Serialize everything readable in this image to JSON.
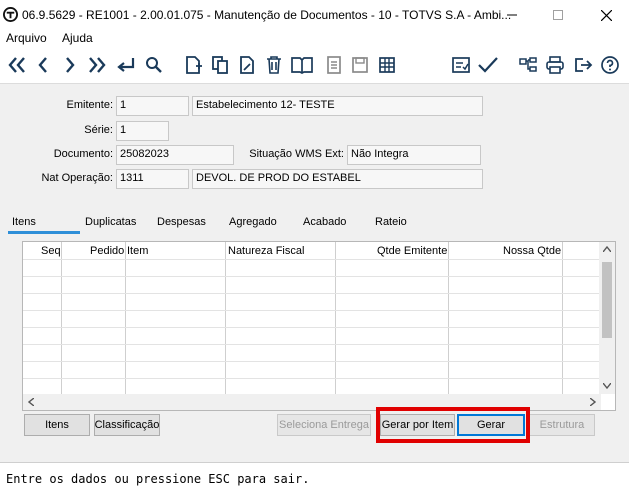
{
  "window": {
    "title": "06.9.5629 - RE1001 - 2.00.01.075 - Manutenção de Documentos - 10 - TOTVS S.A - Ambi..."
  },
  "menu": {
    "items": [
      "Arquivo",
      "Ajuda"
    ]
  },
  "toolbar": {
    "icons": [
      "first-icon",
      "previous-icon",
      "next-icon",
      "last-icon",
      "goto-icon",
      "search-icon",
      "new-icon",
      "copy-icon",
      "edit-icon",
      "delete-icon",
      "book-icon",
      "document-icon",
      "save-icon",
      "grid-icon",
      "checklist-icon",
      "confirm-icon",
      "tree-icon",
      "print-icon",
      "exit-icon",
      "help-icon"
    ]
  },
  "form": {
    "emitente": {
      "label": "Emitente:",
      "code": "1",
      "name": "Estabelecimento 12- TESTE"
    },
    "serie": {
      "label": "Série:",
      "value": "1"
    },
    "documento": {
      "label": "Documento:",
      "value": "25082023"
    },
    "situacao": {
      "label": "Situação WMS Ext:",
      "value": "Não Integra"
    },
    "nat_operacao": {
      "label": "Nat Operação:",
      "code": "1311",
      "desc": "DEVOL. DE PROD DO ESTABEL"
    }
  },
  "tabs": [
    "Itens",
    "Duplicatas",
    "Despesas",
    "Agregado",
    "Acabado",
    "Rateio"
  ],
  "active_tab": "Itens",
  "grid": {
    "columns": [
      "Seq",
      "Pedido",
      "Item",
      "Natureza Fiscal",
      "Qtde Emitente",
      "Nossa Qtde"
    ],
    "rows": []
  },
  "buttons": {
    "itens": "Itens",
    "classificacao": "Classificação",
    "seleciona_entrega": "Seleciona Entrega",
    "gerar_por_item": "Gerar por Item",
    "gerar": "Gerar",
    "estrutura": "Estrutura"
  },
  "status": {
    "message": "Entre os dados ou pressione ESC para sair."
  },
  "colors": {
    "accent": "#2e8fd8",
    "highlight": "#e00000",
    "focus": "#0078d7"
  }
}
